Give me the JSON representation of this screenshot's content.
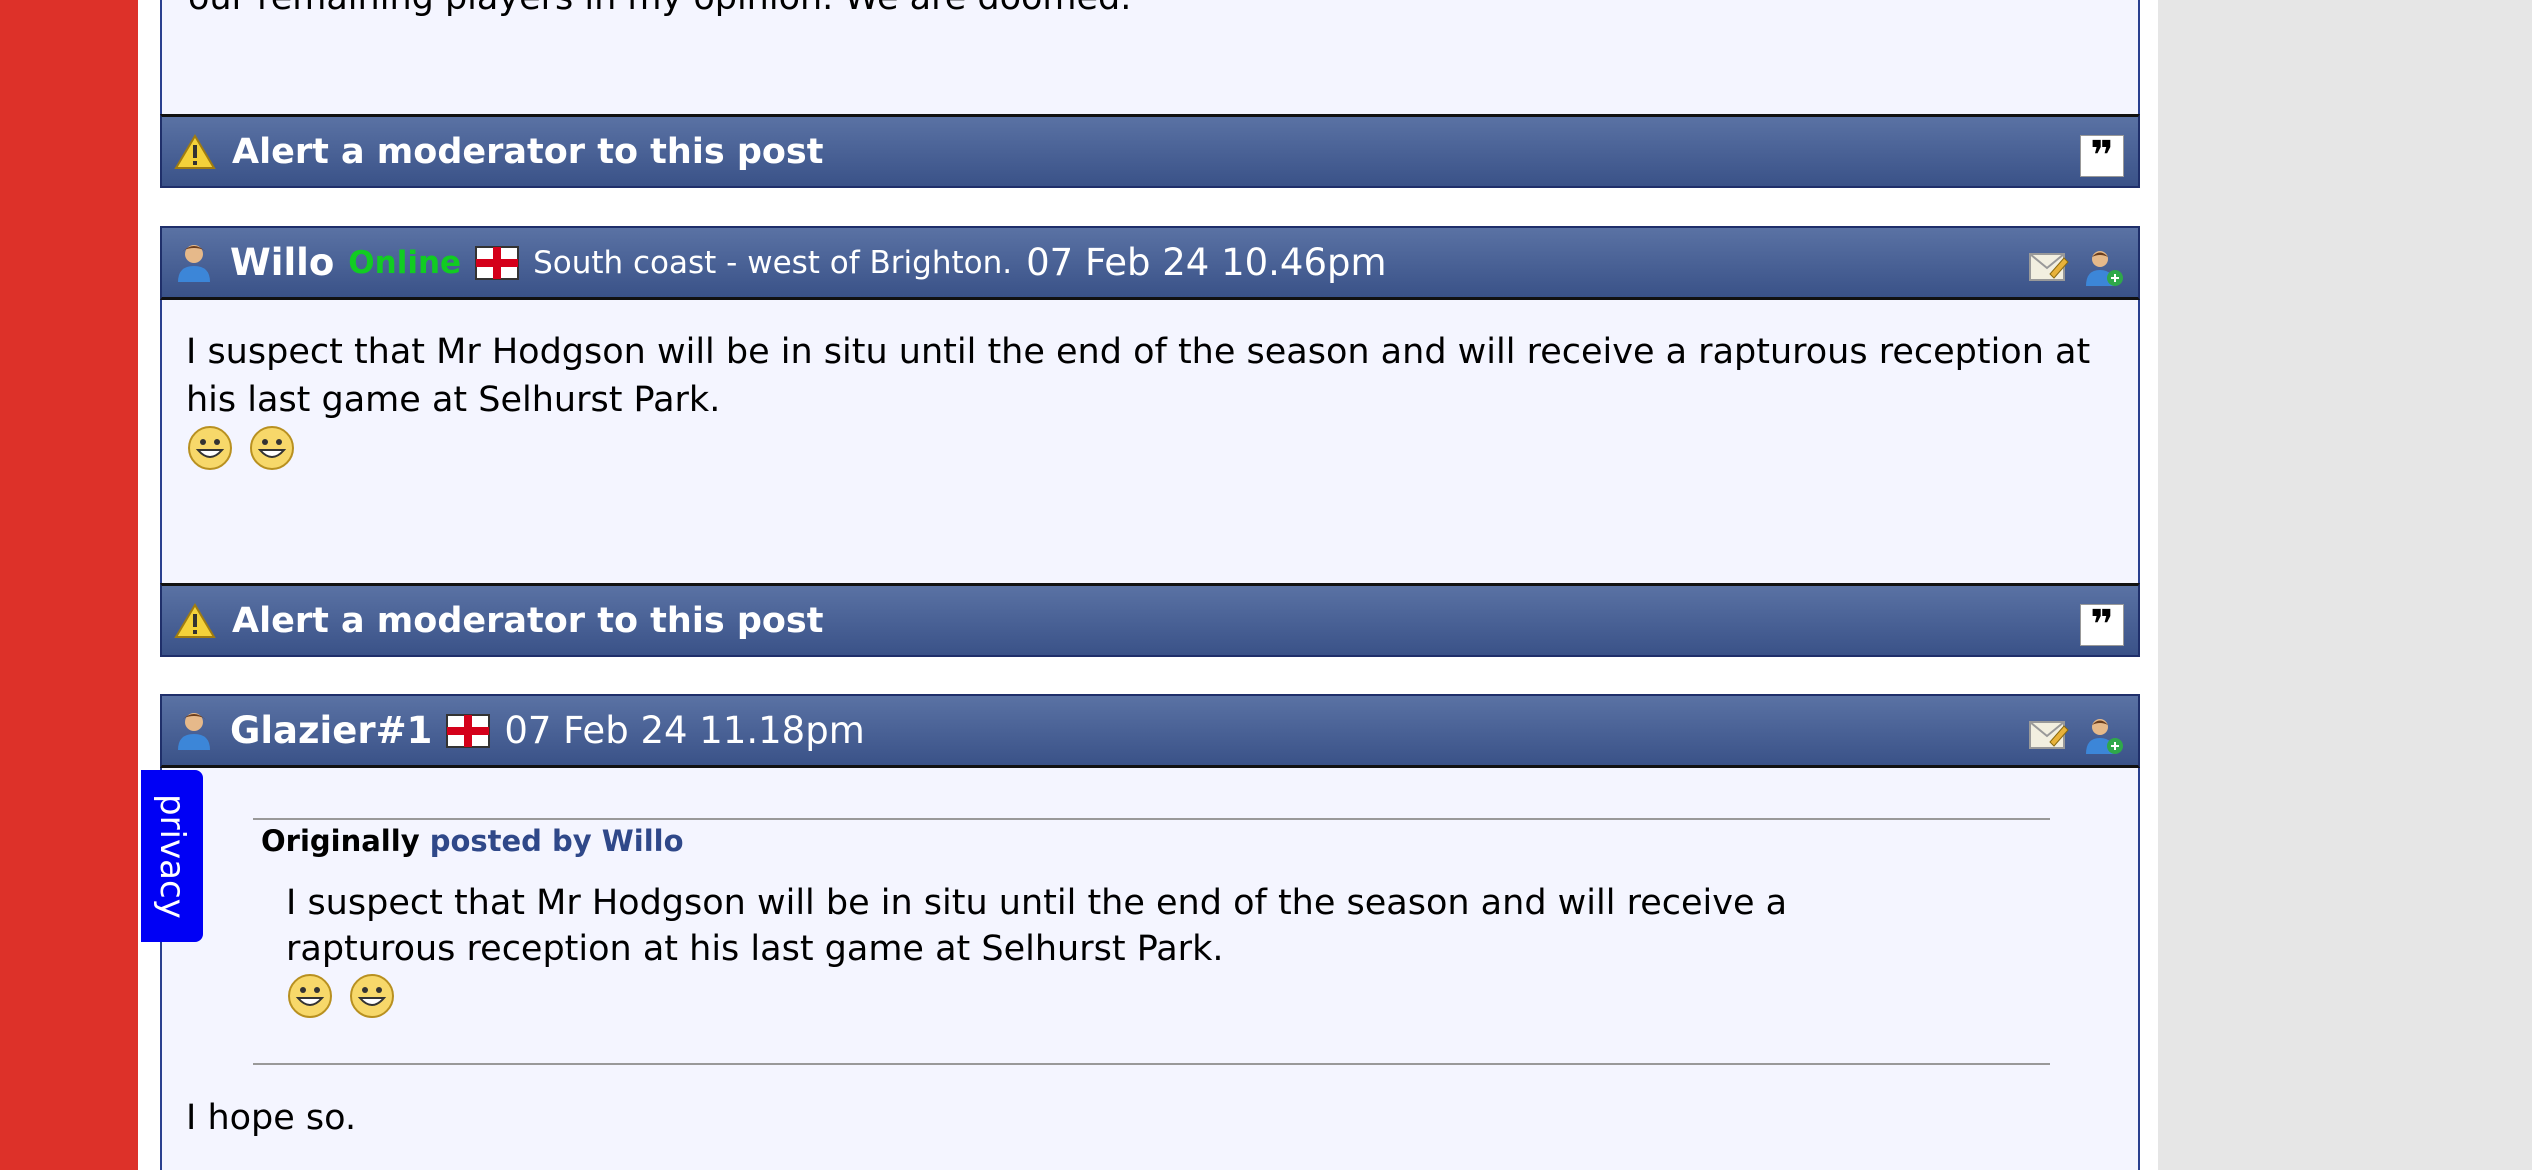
{
  "colors": {
    "left_bar": "#dd3129",
    "bar": "#3f578c",
    "body": "#f4f5ff",
    "online": "#11cc22",
    "quote_link": "#2f4889"
  },
  "prev_post": {
    "text": "our remaining players in my opinion. We are doomed."
  },
  "footer": {
    "alert_label": "Alert a moderator to this post",
    "warning_icon": "warning-icon",
    "quote_icon": "quote-icon"
  },
  "posts": [
    {
      "username": "Willo",
      "status": "Online",
      "flag_icon": "england-flag-icon",
      "location": "South coast - west of Brighton.",
      "date": "07 Feb 24 10.46pm",
      "text": "I suspect that Mr Hodgson will be in situ until the end of the season and will receive a rapturous reception at his last game at Selhurst Park."
    },
    {
      "username": "Glazier#1",
      "flag_icon": "england-flag-icon",
      "date": "07 Feb 24 11.18pm",
      "quote": {
        "originally": "Originally",
        "posted_by": "posted by Willo",
        "text": "I suspect that Mr Hodgson will be in situ until the end of the season and will receive a rapturous reception at his last game at Selhurst Park."
      },
      "reply": "I hope so."
    }
  ],
  "privacy_tab": "privacy"
}
